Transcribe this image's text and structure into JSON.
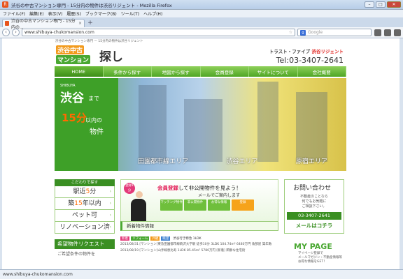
{
  "window": {
    "title": "渋谷の中古マンション専門 - 15分内の物件は渋谷リジェント - Mozilla Firefox"
  },
  "menu": [
    "ファイル(F)",
    "編集(E)",
    "表示(V)",
    "履歴(S)",
    "ブックマーク(B)",
    "ツール(T)",
    "ヘルプ(H)"
  ],
  "tab": {
    "label": "渋谷の中古マンション専門 - 15分内の..."
  },
  "nav": {
    "url": "www.shibuya-chukomansion.com",
    "search_placeholder": "Google"
  },
  "site": {
    "tagline": "渋谷の中古マンション専門 ー 15分内の物件は渋谷リジェント",
    "logo_line1": "渋谷中古",
    "logo_line2": "マンション",
    "logo_line3": "探し",
    "brand_a": "トラスト・ファイブ",
    "brand_b": "渋谷リジェント",
    "tel": "Tel:03-3407-2641",
    "gnav": [
      "HOME",
      "条件から探す",
      "地図から探す",
      "会員登録",
      "サイトについて",
      "会社概要"
    ],
    "hero": {
      "shibuya_en": "SHIBUYA",
      "big": "渋谷",
      "made": "まで",
      "minutes": "15分",
      "inai": "以内の",
      "bukken": "物件",
      "areas": [
        "田園都市線エリア",
        "渋谷エリア",
        "原宿エリア"
      ]
    },
    "side": {
      "header": "こだわりで探す",
      "items": [
        {
          "pre": "駅近",
          "hl": "5",
          "post": "分"
        },
        {
          "pre": "築",
          "hl": "15",
          "post": "年以内"
        },
        {
          "pre": "ペット可",
          "hl": "",
          "post": ""
        },
        {
          "pre": "リノベーション済",
          "hl": "",
          "post": ""
        }
      ],
      "request": "希望物件リクエスト",
      "request_sub": "ご希望条件の物件を"
    },
    "member": {
      "badge": "登録1分",
      "headline_pre": "会員登録",
      "headline_post": "して非公開物件を見よう！",
      "sub": "メールでご案内します",
      "buttons": [
        "マッチング物件",
        "非公開物件",
        "お得な情報",
        "登録"
      ]
    },
    "news": {
      "header": "新着物件情報",
      "tags": [
        "新着",
        "リフォーム",
        "外観",
        "眺望"
      ],
      "tag_text": "渋谷行き特急 1LDK",
      "line1": "2013/08/31 [マンション]東急田園都市線駒沢大学駅 徒歩10分 3LDK 104.74m² 6480万円 角部屋 築年数",
      "line2": "2013/08/19 [マンション]山手線恵比寿 1LDK 85.45m² 5780万円 [新着] 閑静な住宅街"
    },
    "contact": {
      "head": "お問い合わせ",
      "text": "不動産のことなら\n何でもお気軽に\nご相談下さい。",
      "tel": "03-3407-2641",
      "mail": "メールはコチラ"
    },
    "mypage": {
      "head": "MY PAGE",
      "text": "マイページ登録で\nメールマガジン・不動産情報等\nお得な情報をGET！"
    }
  },
  "statusbar": "www.shibuya-chukomansion.com"
}
